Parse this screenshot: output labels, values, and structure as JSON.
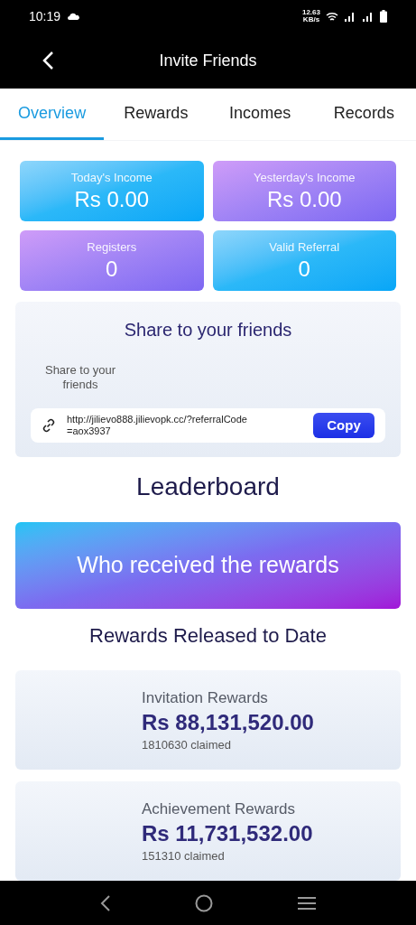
{
  "status_bar": {
    "time": "10:19",
    "speed": "12.63",
    "speed_unit": "KB/s"
  },
  "header": {
    "title": "Invite Friends"
  },
  "tabs": [
    {
      "label": "Overview",
      "selected": true
    },
    {
      "label": "Rewards",
      "selected": false
    },
    {
      "label": "Incomes",
      "selected": false
    },
    {
      "label": "Records",
      "selected": false
    }
  ],
  "stats": [
    {
      "label": "Today's Income",
      "currency": "Rs",
      "value": "0.00",
      "kind": "cyan"
    },
    {
      "label": "Yesterday's Income",
      "currency": "Rs",
      "value": "0.00",
      "kind": "violet"
    },
    {
      "label": "Registers",
      "value": "0",
      "kind": "violet"
    },
    {
      "label": "Valid Referral",
      "value": "0",
      "kind": "cyan"
    }
  ],
  "share": {
    "title": "Share to your friends",
    "caption": "Share to your friends",
    "link": "http://jilievo888.jilievopk.cc/?referralCode=aox3937",
    "button": "Copy"
  },
  "leaderboard": {
    "title": "Leaderboard",
    "banner": "Who received the rewards",
    "subtitle": "Rewards Released to Date"
  },
  "rewards": [
    {
      "title": "Invitation Rewards",
      "currency": "Rs",
      "amount": "88,131,520.00",
      "claimed": "1810630 claimed"
    },
    {
      "title": "Achievement Rewards",
      "currency": "Rs",
      "amount": "11,731,532.00",
      "claimed": "151310 claimed"
    }
  ]
}
